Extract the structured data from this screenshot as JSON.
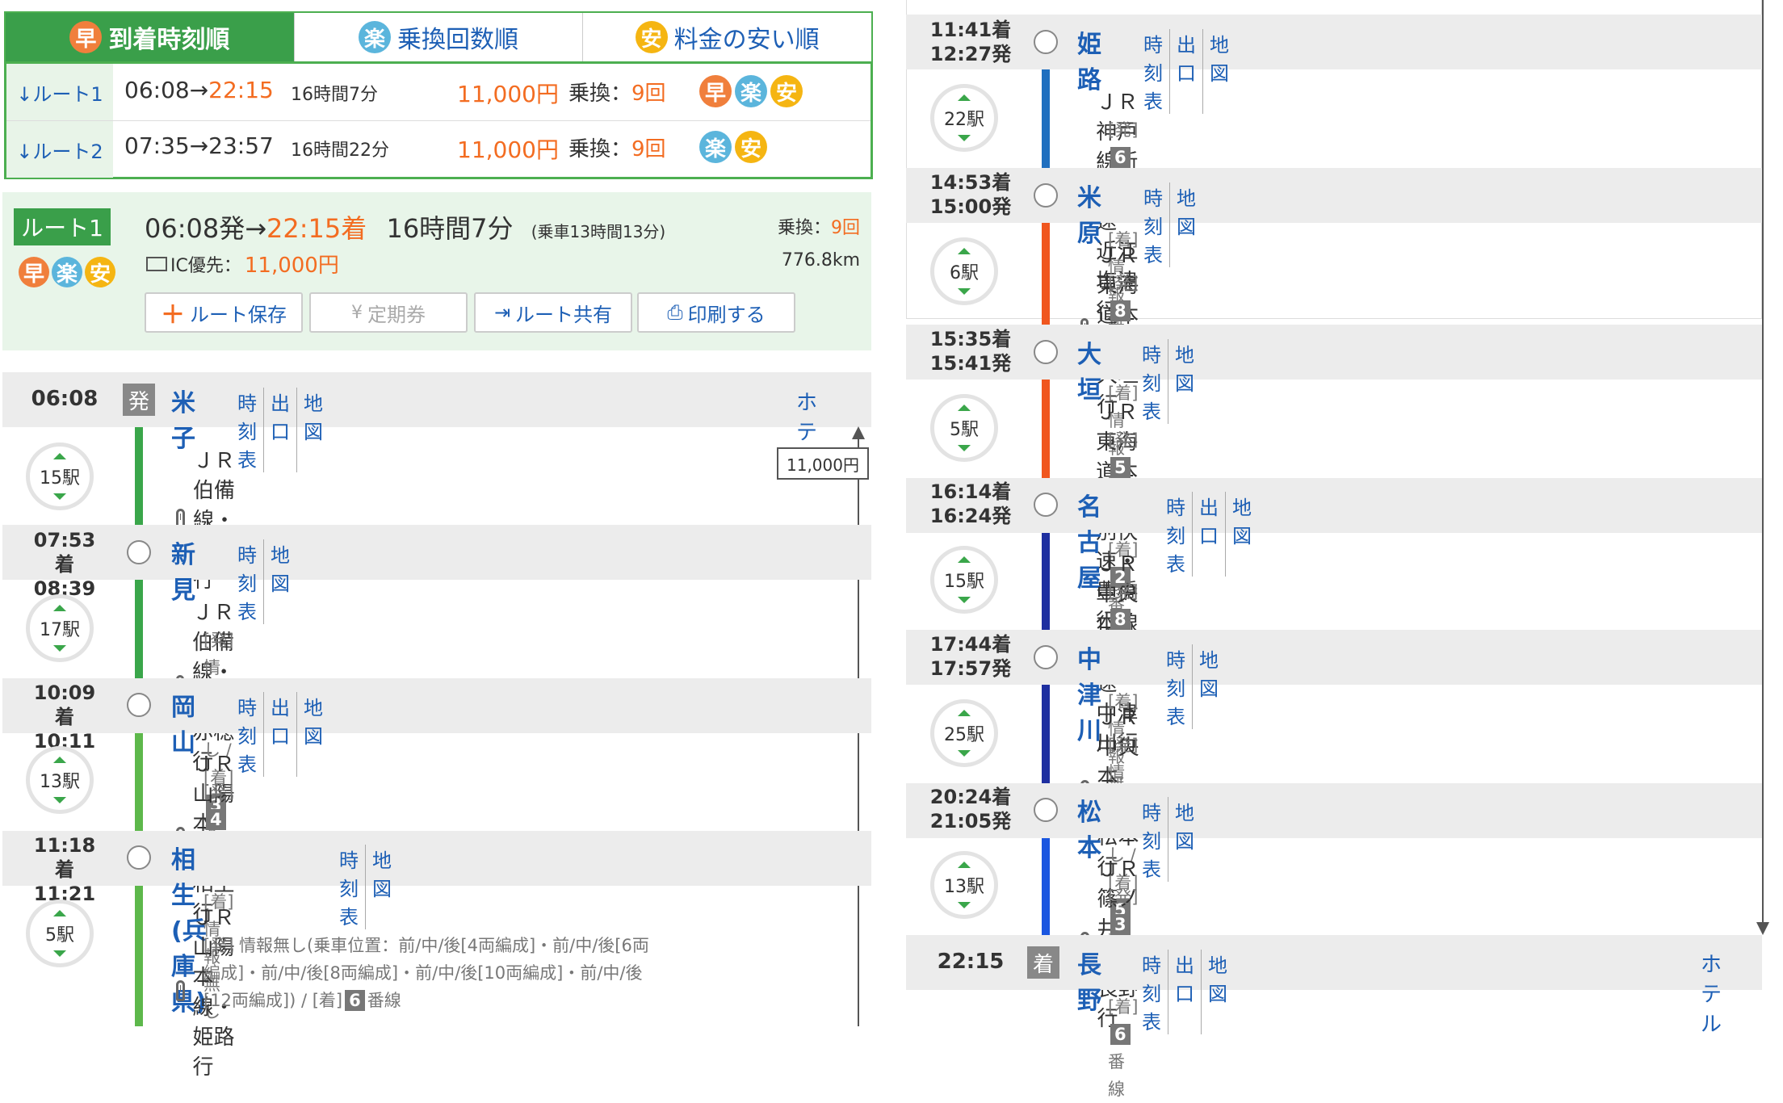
{
  "tabs": [
    {
      "label": "到着時刻順",
      "icon": "早"
    },
    {
      "label": "乗換回数順",
      "icon": "楽"
    },
    {
      "label": "料金の安い順",
      "icon": "安"
    }
  ],
  "route_list": [
    {
      "label": "↓ルート1",
      "dep": "06:08",
      "arrow": "→",
      "arr": "22:15",
      "dur": "16時間7分",
      "fare": "11,000円",
      "xfer_label": "乗換：",
      "xfer": "9回",
      "badges": [
        "早",
        "楽",
        "安"
      ]
    },
    {
      "label": "↓ルート2",
      "dep": "07:35",
      "arrow": "→",
      "arr": "23:57",
      "dur": "16時間22分",
      "fare": "11,000円",
      "xfer_label": "乗換：",
      "xfer": "9回",
      "badges": [
        "楽",
        "安"
      ]
    }
  ],
  "summary": {
    "route_label": "ルート1",
    "dep": "06:08発→",
    "arr": "22:15着",
    "dur": "16時間7分",
    "ride": "(乗車13時間13分)",
    "xfer_label": "乗換：",
    "xfer": "9回",
    "ic_label": "IC優先：",
    "fare": "11,000円",
    "distance": "776.8km",
    "badges": [
      "早",
      "楽",
      "安"
    ],
    "buttons": {
      "save": "ルート保存",
      "pass": "定期券",
      "share": "ルート共有",
      "print": "印刷する"
    }
  },
  "fare_tag": "11,000円",
  "hotel_label": "ホテル",
  "left": {
    "stations": [
      {
        "time": "06:08",
        "mark": "発",
        "name": "米子",
        "links": [
          "時刻表",
          "出口",
          "地図"
        ]
      },
      {
        "time1": "07:53着",
        "time2": "08:39発",
        "name": "新見",
        "links": [
          "時刻表",
          "地図"
        ]
      },
      {
        "time1": "10:09着",
        "time2": "10:11発",
        "name": "岡山",
        "links": [
          "時刻表",
          "出口",
          "地図"
        ]
      },
      {
        "time1": "11:18着",
        "time2": "11:21発",
        "name": "相生(兵庫県)",
        "links": [
          "時刻表",
          "地図"
        ]
      }
    ],
    "segments": [
      {
        "count": "15駅",
        "train": "ＪＲ伯備線・新見行",
        "plat": ""
      },
      {
        "count": "17駅",
        "train": "ＪＲ伯備線・播州赤穂行",
        "plat_a": "[発] 情報無し / [着]",
        "pn": "3",
        "plat_b": "番線"
      },
      {
        "count": "13駅",
        "train": "ＪＲ山陽本線・相生行",
        "plat_pre": "[発]",
        "pn": "4",
        "plat_b": "番線 / [着] 情報無し"
      },
      {
        "count": "5駅",
        "train": "ＪＲ山陽本線・姫路行",
        "plat_l1": "[発] 情報無し(乗車位置：前/中/後[4両編成]・前/中/後[6両",
        "plat_l2": "編成]・前/中/後[8両編成]・前/中/後[10両編成]・前/中/後",
        "plat_l3": "[12両編成]) / [着]",
        "pn": "6",
        "plat_b": "番線"
      }
    ]
  },
  "right": {
    "stations": [
      {
        "time1": "11:41着",
        "time2": "12:27発",
        "name": "姫路",
        "links": [
          "時刻表",
          "出口",
          "地図"
        ]
      },
      {
        "time1": "14:53着",
        "time2": "15:00発",
        "name": "米原",
        "links": [
          "時刻表",
          "地図"
        ]
      },
      {
        "time1": "15:35着",
        "time2": "15:41発",
        "name": "大垣",
        "links": [
          "時刻表",
          "地図"
        ]
      },
      {
        "time1": "16:14着",
        "time2": "16:24発",
        "name": "名古屋",
        "links": [
          "時刻表",
          "出口",
          "地図"
        ]
      },
      {
        "time1": "17:44着",
        "time2": "17:57発",
        "name": "中津川",
        "links": [
          "時刻表",
          "地図"
        ]
      },
      {
        "time1": "20:24着",
        "time2": "21:05発",
        "name": "松本",
        "links": [
          "時刻表",
          "地図"
        ]
      },
      {
        "time": "22:15",
        "mark": "着",
        "name": "長野",
        "links": [
          "時刻表",
          "出口",
          "地図"
        ]
      }
    ],
    "segments": [
      {
        "count": "22駅",
        "train": "ＪＲ神戸線新快速・近江塩津行",
        "pre": "[発]",
        "pn": "6",
        "post": "番線 / [着] 情報無し"
      },
      {
        "count": "6駅",
        "train": "ＪＲ東海道本線・大垣行",
        "pre": "[発]",
        "pn": "8",
        "post": "番線 / [着] 情報無し"
      },
      {
        "count": "5駅",
        "train": "ＪＲ東海道本線特別快速・豊橋行",
        "pre": "[発]",
        "pn": "5",
        "post": "番線 / [着]",
        "pn2": "2",
        "post2": "番線"
      },
      {
        "count": "15駅",
        "train": "ＪＲ中央本線快速・中津川行",
        "pre": "[発]",
        "pn": "8",
        "post": "番線 / [着] 情報無し"
      },
      {
        "count": "25駅",
        "train": "ＪＲ中央本線・松本行",
        "pre": "[発] 情報無し / [着]",
        "pn": "5",
        "post": "番線"
      },
      {
        "count": "13駅",
        "train": "ＪＲ篠ノ井線・長野行",
        "pre": "[発]",
        "pn": "3",
        "post": "番線 / [着]",
        "pn2": "6",
        "post2": "番線"
      }
    ]
  },
  "colors": {
    "green": "#3aa64a",
    "light_green": "#5db84b",
    "blue": "#1f6fbf",
    "orange": "#f0561e",
    "navy": "#1e2fa0",
    "royal": "#1a56e0",
    "link": "#1d5fb5",
    "accent": "#f36c21"
  }
}
